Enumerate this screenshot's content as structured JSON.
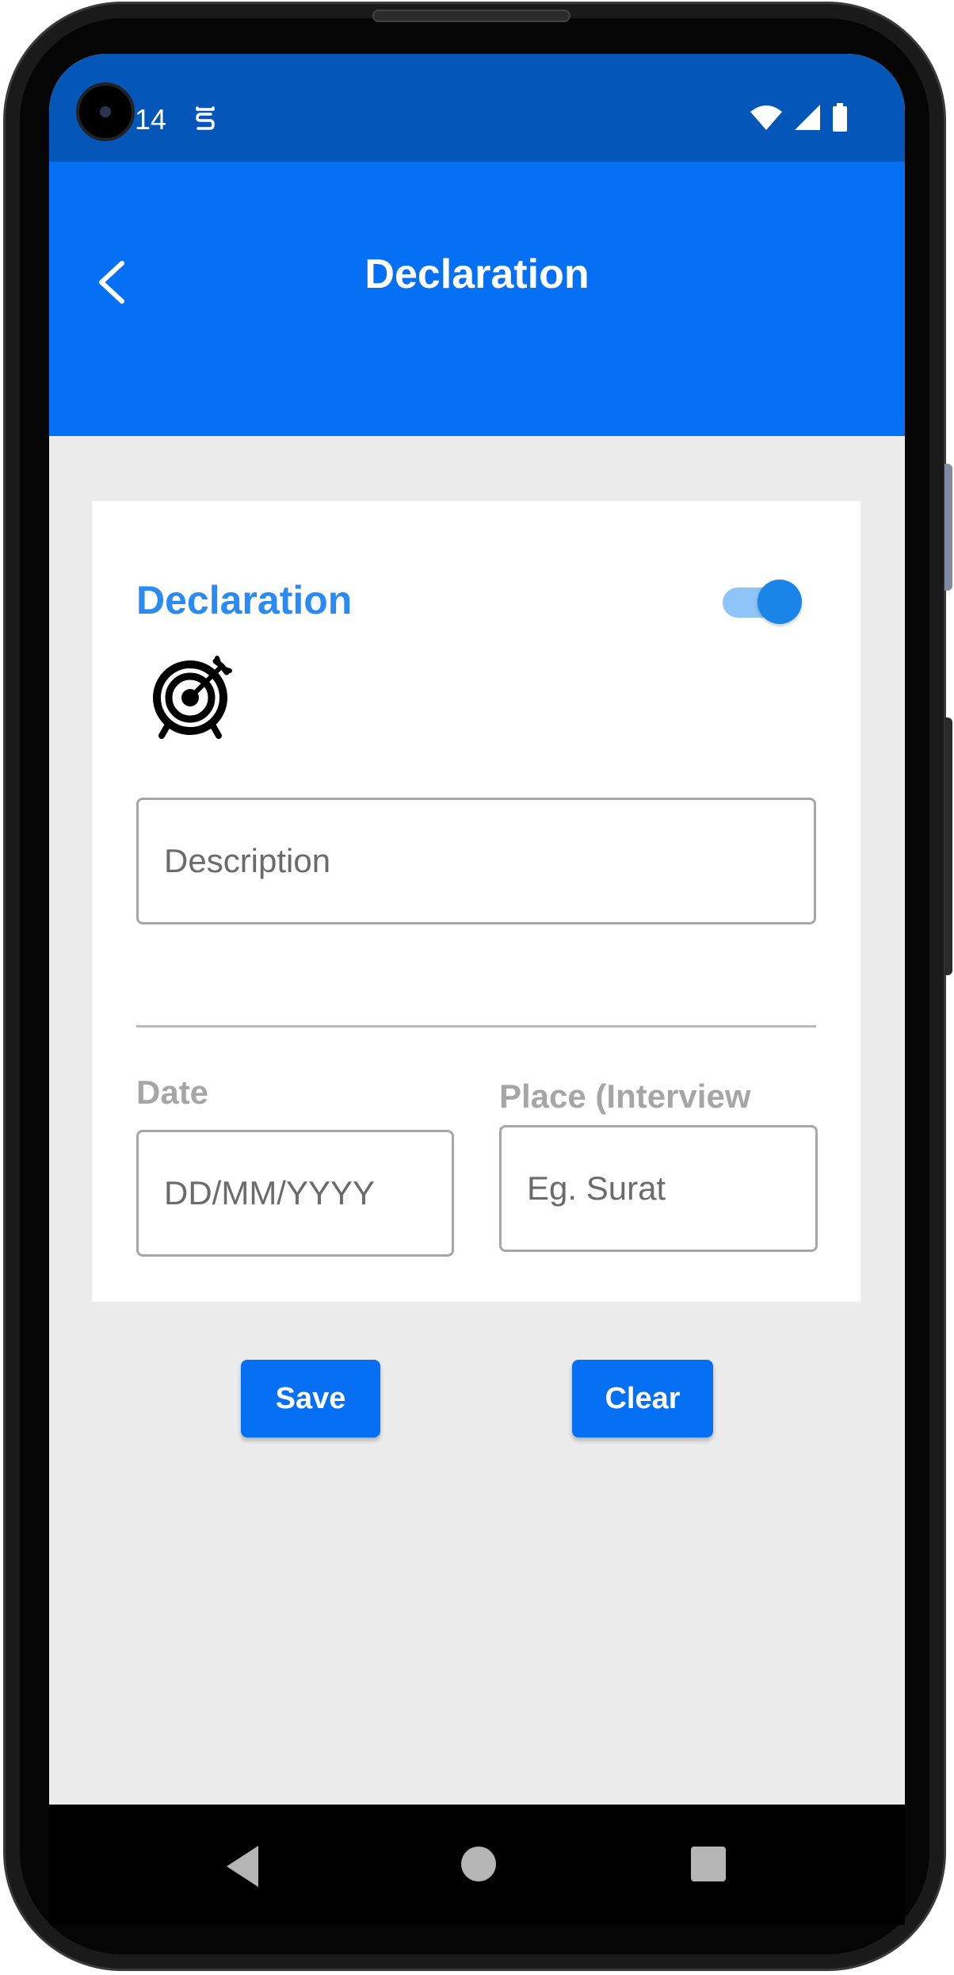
{
  "status_bar": {
    "time": "14",
    "icons": [
      "camera-icon",
      "s-notification-icon",
      "wifi-icon",
      "signal-icon",
      "battery-icon"
    ]
  },
  "app_bar": {
    "title": "Declaration",
    "back_icon": "chevron-left-icon",
    "color": "#0670f5"
  },
  "card": {
    "title": "Declaration",
    "toggle_on": true,
    "icon": "target-icon",
    "description": {
      "value": "",
      "placeholder": "Description"
    },
    "date": {
      "label": "Date",
      "value": "",
      "placeholder": "DD/MM/YYYY"
    },
    "place": {
      "label": "Place (Interview Venue/City)",
      "value": "",
      "placeholder": "Eg. Surat"
    }
  },
  "actions": {
    "save_label": "Save",
    "clear_label": "Clear"
  },
  "nav_bar": {
    "icons": [
      "nav-back-icon",
      "nav-home-icon",
      "nav-recents-icon"
    ]
  },
  "colors": {
    "primary": "#0670f5",
    "status_bar": "#0456b8",
    "accent_title": "#2a8bf2",
    "background": "#ececec"
  }
}
